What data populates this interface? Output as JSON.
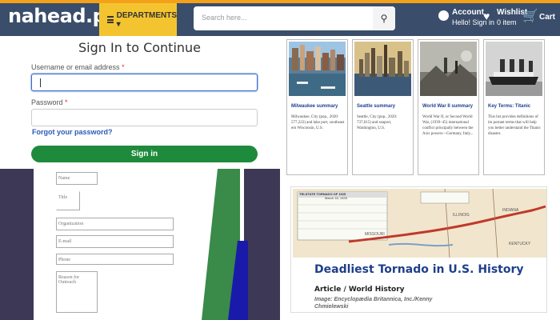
{
  "header": {
    "logo": "nahead.pk",
    "departments_label": "DEPARTMENTS ▾",
    "search_placeholder": "Search here...",
    "account_title": "Account",
    "account_sub": "Hello! Sign in",
    "wishlist_title": "Wishlist",
    "wishlist_sub": "0 item",
    "cart_label": "Cart",
    "cart_count": "0",
    "colors": {
      "bar": "#3a4d6b",
      "accent": "#f4c430"
    }
  },
  "signin": {
    "title": "Sign In to Continue",
    "username_label": "Username or email address",
    "password_label": "Password",
    "required_mark": "*",
    "forgot_link": "Forgot your password?",
    "submit_label": "Sign in"
  },
  "contact_form": {
    "name_placeholder": "Name",
    "title_placeholder": "Title",
    "organization_placeholder": "Organization",
    "email_placeholder": "E-mail",
    "phone_placeholder": "Phone",
    "reason_placeholder": "Reason for Outreach"
  },
  "cards": [
    {
      "title": "Milwaukee summary",
      "desc": "Milwaukee, City (pop., 2020: 577,222) and lake port, southeast ern Wisconsin, U.S."
    },
    {
      "title": "Seattle summary",
      "desc": "Seattle, City (pop., 2020: 737,015) and seaport, Washington, U.S."
    },
    {
      "title": "World War II summary",
      "desc": "World War II, or Second World War, (1939–45) international conflict principally between the Axis powers—Germany, Italy..."
    },
    {
      "title": "Key Terms: Titanic",
      "desc": "This list provides definitions of im portant terms that will help you better understand the Titanic disaster."
    }
  ],
  "tornado": {
    "title": "Deadliest Tornado in U.S. History",
    "subtitle": "Article / World History",
    "caption": "Image: Encyclopædia Britannica, Inc./Kenny Chmielewski",
    "map_header": "TRI-STATE TORNADO OF 1925",
    "map_date": "March 18, 1925",
    "states": [
      "MISSOURI",
      "ILLINOIS",
      "INDIANA",
      "KENTUCKY"
    ]
  }
}
